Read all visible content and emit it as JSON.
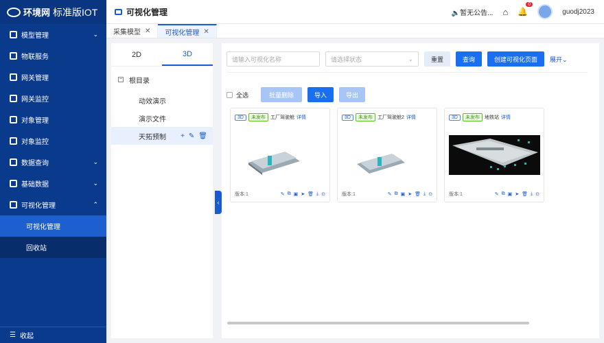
{
  "app": {
    "brand": "环境网",
    "edition": "标准版IOT"
  },
  "sidebar": {
    "items": [
      {
        "label": "模型管理",
        "chev": "⌄"
      },
      {
        "label": "物联服务",
        "chev": ""
      },
      {
        "label": "网关管理",
        "chev": ""
      },
      {
        "label": "网关监控",
        "chev": ""
      },
      {
        "label": "对象管理",
        "chev": ""
      },
      {
        "label": "对象监控",
        "chev": ""
      },
      {
        "label": "数据查询",
        "chev": "⌄"
      },
      {
        "label": "基础数据",
        "chev": "⌄"
      },
      {
        "label": "可视化管理",
        "chev": "⌃"
      }
    ],
    "sub": [
      {
        "label": "可视化管理"
      },
      {
        "label": "回收站"
      }
    ],
    "collapse": "收起"
  },
  "header": {
    "title": "可视化管理",
    "notice": "暂无公告...",
    "badge": "0",
    "user": "guodj2023"
  },
  "tabs": [
    {
      "label": "采集模型"
    },
    {
      "label": "可视化管理"
    }
  ],
  "leftpanel": {
    "tabs": [
      "2D",
      "3D"
    ],
    "root": "根目录",
    "items": [
      {
        "label": "动效演示"
      },
      {
        "label": "演示文件"
      },
      {
        "label": "天拓预制"
      }
    ]
  },
  "filters": {
    "name_placeholder": "请输入可视化名称",
    "status_placeholder": "请选择状态",
    "reset": "重置",
    "query": "查询",
    "create": "创建可视化页面",
    "expand": "展开"
  },
  "actions": {
    "select_all": "全选",
    "batch_delete": "批量删除",
    "import": "导入",
    "export": "导出"
  },
  "cards": [
    {
      "tag": "3D",
      "status": "未发布",
      "name": "工厂驾驶舱",
      "detail": "详情",
      "version": "版本:1"
    },
    {
      "tag": "3D",
      "status": "未发布",
      "name": "工厂驾驶舱2",
      "detail": "详情",
      "version": "版本:1"
    },
    {
      "tag": "3D",
      "status": "未发布",
      "name": "地铁站",
      "detail": "详情",
      "version": "版本:1"
    }
  ]
}
